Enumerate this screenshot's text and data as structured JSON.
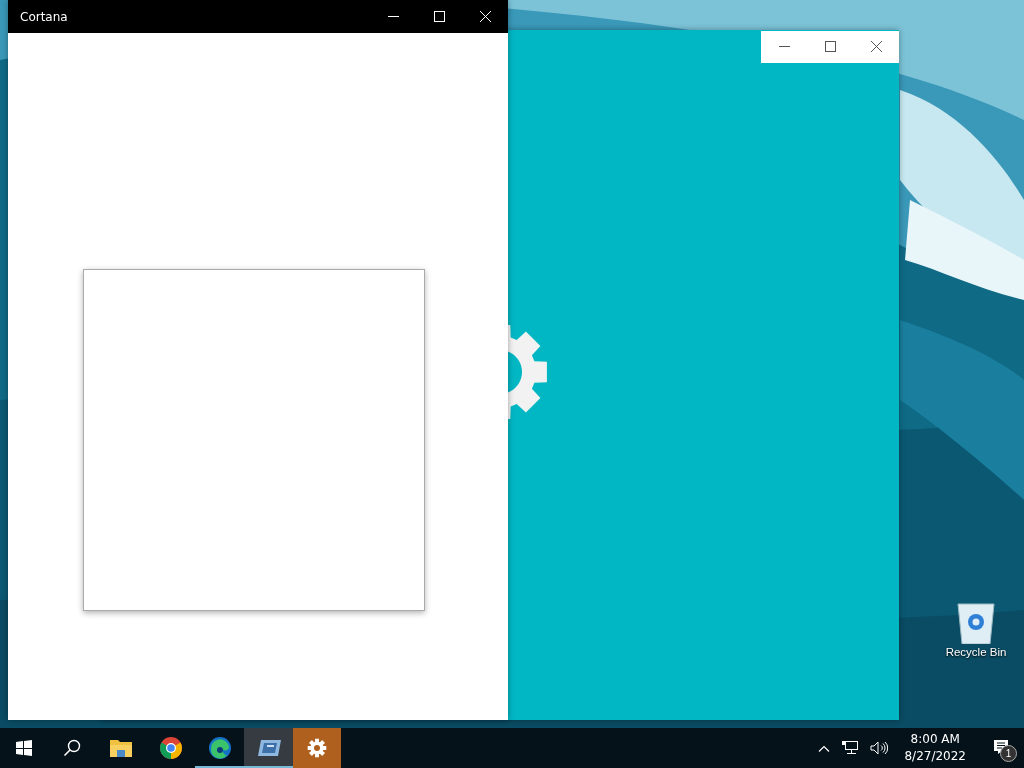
{
  "desktop": {
    "icons": [
      {
        "label": "Recycle Bin"
      }
    ]
  },
  "windows": [
    {
      "kind": "splash"
    },
    {
      "kind": "cortana",
      "title": "Cortana"
    }
  ],
  "taskbar": {
    "items": [
      {
        "kind": "start",
        "running": false,
        "hovered": false,
        "selected": false
      },
      {
        "kind": "search",
        "running": false,
        "hovered": false,
        "selected": false
      },
      {
        "kind": "explorer",
        "running": false,
        "hovered": false,
        "selected": false
      },
      {
        "kind": "chrome",
        "running": false,
        "hovered": false,
        "selected": false
      },
      {
        "kind": "edge",
        "running": true,
        "hovered": false,
        "selected": false
      },
      {
        "kind": "app",
        "running": true,
        "hovered": true,
        "selected": false
      },
      {
        "kind": "settings",
        "running": false,
        "hovered": false,
        "selected": true
      }
    ],
    "time": "8:00 AM",
    "date": "8/27/2022",
    "notification_count": "1"
  }
}
